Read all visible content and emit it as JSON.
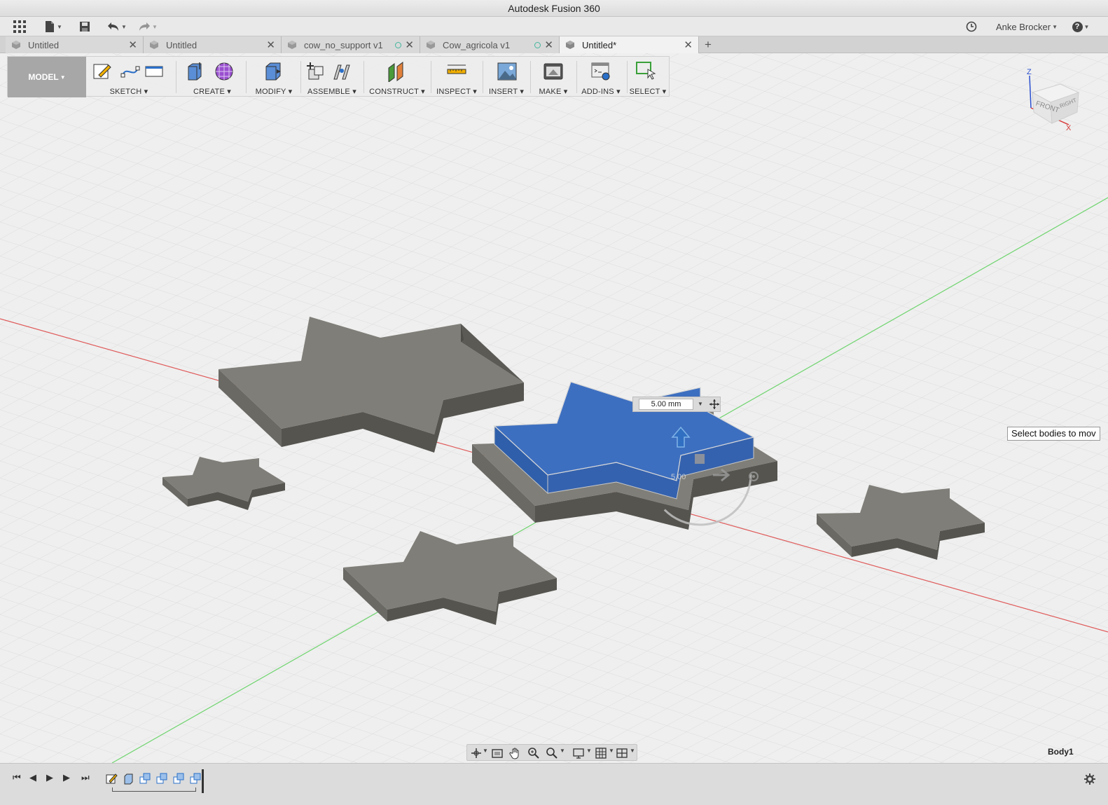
{
  "window": {
    "title": "Autodesk Fusion 360"
  },
  "toolbar": {
    "user_name": "Anke Brocker",
    "help_label": "?",
    "icons": [
      "grid-icon",
      "file-icon",
      "save-icon",
      "undo-icon",
      "redo-icon",
      "clock-icon"
    ]
  },
  "tabs": [
    {
      "label": "Untitled",
      "active": false,
      "status": false
    },
    {
      "label": "Untitled",
      "active": false,
      "status": false
    },
    {
      "label": "cow_no_support v1",
      "active": false,
      "status": true
    },
    {
      "label": "Cow_agricola v1",
      "active": false,
      "status": true
    },
    {
      "label": "Untitled*",
      "active": true,
      "status": false
    }
  ],
  "ribbon": {
    "workspace": "MODEL",
    "groups": [
      {
        "label": "SKETCH"
      },
      {
        "label": "CREATE"
      },
      {
        "label": "MODIFY"
      },
      {
        "label": "ASSEMBLE"
      },
      {
        "label": "CONSTRUCT"
      },
      {
        "label": "INSPECT"
      },
      {
        "label": "INSERT"
      },
      {
        "label": "MAKE"
      },
      {
        "label": "ADD-INS"
      },
      {
        "label": "SELECT"
      }
    ]
  },
  "viewcube": {
    "front": "FRONT",
    "right": "RIGHT",
    "z": "Z",
    "x": "X"
  },
  "move": {
    "distance": "5.00 mm",
    "manipulator_value": "5.00",
    "tooltip": "Select bodies to mov"
  },
  "status": {
    "selected_body": "Body1"
  },
  "colors": {
    "selected_body": "#3d6fc0",
    "body": "#7c7b75",
    "x_axis": "#e05a5a",
    "y_axis": "#6ed46e"
  }
}
